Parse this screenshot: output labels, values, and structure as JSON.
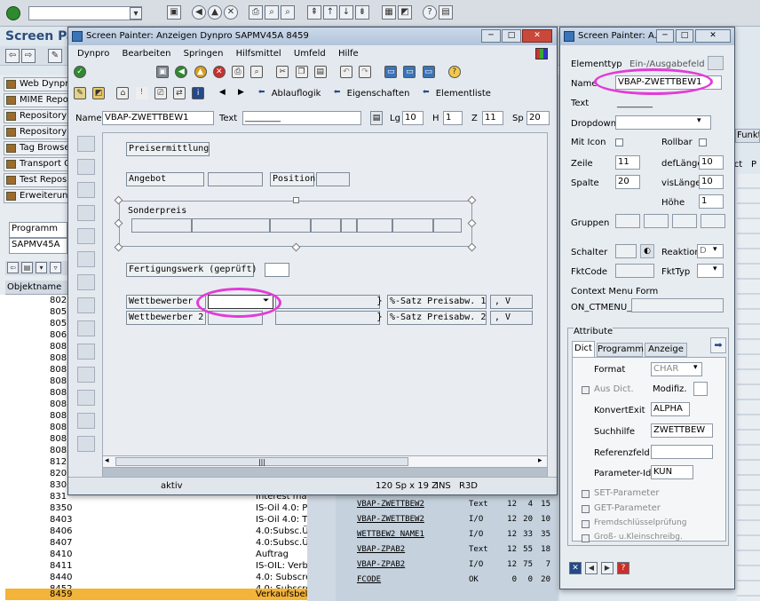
{
  "topbar": {
    "command_value": ""
  },
  "background": {
    "title": "Screen Pa",
    "left_buttons": [
      "Web Dynpro",
      "MIME Repos",
      "Repository B",
      "Repository I",
      "Tag Browse",
      "Transport O",
      "Test Reposi",
      "Erweiterung"
    ],
    "program_label": "Programm",
    "program_value": "SAPMV45A",
    "list_header": "Objektname",
    "list_rows": [
      {
        "n": "802",
        "d": ""
      },
      {
        "n": "805",
        "d": ""
      },
      {
        "n": "805",
        "d": ""
      },
      {
        "n": "806",
        "d": ""
      },
      {
        "n": "808",
        "d": ""
      },
      {
        "n": "808",
        "d": ""
      },
      {
        "n": "808",
        "d": ""
      },
      {
        "n": "808",
        "d": ""
      },
      {
        "n": "808",
        "d": ""
      },
      {
        "n": "808",
        "d": ""
      },
      {
        "n": "808",
        "d": ""
      },
      {
        "n": "808",
        "d": ""
      },
      {
        "n": "808",
        "d": ""
      },
      {
        "n": "808",
        "d": ""
      },
      {
        "n": "812",
        "d": ""
      },
      {
        "n": "820",
        "d": ""
      },
      {
        "n": "830",
        "d": ""
      },
      {
        "n": "831",
        "d": "Interest ma"
      },
      {
        "n": "8350",
        "d": "IS-Oil 4.0: P"
      },
      {
        "n": "8403",
        "d": "IS-Oil 4.0: T"
      },
      {
        "n": "8406",
        "d": "4.0:Subsc.Ü"
      },
      {
        "n": "8407",
        "d": "4.0:Subsc.Ü"
      },
      {
        "n": "8410",
        "d": "Auftrag"
      },
      {
        "n": "8411",
        "d": "IS-OIL: Verb"
      },
      {
        "n": "8440",
        "d": "4.0: Subscre"
      },
      {
        "n": "8452",
        "d": "4.0: Subscre"
      },
      {
        "n": "8459",
        "d": "Verkaufsbel"
      }
    ],
    "right_tab_label": "Funkti",
    "right_cols": [
      "ict",
      "P"
    ],
    "table_rows": [
      {
        "name": "VBAP-ZWETTBEW2",
        "type": "Text",
        "a": "12",
        "b": "4",
        "c": "15"
      },
      {
        "name": "VBAP-ZWETTBEW2",
        "type": "I/O",
        "a": "12",
        "b": "20",
        "c": "10"
      },
      {
        "name": "WETTBEW2_NAME1",
        "type": "I/O",
        "a": "12",
        "b": "33",
        "c": "35"
      },
      {
        "name": "VBAP-ZPAB2",
        "type": "Text",
        "a": "12",
        "b": "55",
        "c": "18"
      },
      {
        "name": "VBAP-ZPAB2",
        "type": "I/O",
        "a": "12",
        "b": "75",
        "c": "7"
      },
      {
        "name": "FCODE",
        "type": "OK",
        "a": "0",
        "b": "0",
        "c": "20"
      }
    ]
  },
  "main_window": {
    "title": "Screen Painter:  Anzeigen Dynpro SAPMV45A 8459",
    "menu": [
      "Dynpro",
      "Bearbeiten",
      "Springen",
      "Hilfsmittel",
      "Umfeld",
      "Hilfe"
    ],
    "toolbar_texts": {
      "ablauflogik": "Ablauflogik",
      "eigenschaften": "Eigenschaften",
      "elementliste": "Elementliste"
    },
    "attr": {
      "name_label": "Name",
      "name_value": "VBAP-ZWETTBEW1",
      "text_label": "Text",
      "text_value": "________",
      "lg_label": "Lg",
      "lg_value": "10",
      "h_label": "H",
      "h_value": "1",
      "z_label": "Z",
      "z_value": "11",
      "sp_label": "Sp",
      "sp_value": "20"
    },
    "screen": {
      "preisermittlung": "Preisermittlung",
      "angebot": "Angebot",
      "position": "Position",
      "sonderpreis": "Sonderpreis",
      "fertigungswerk": "Fertigungswerk (geprüft)",
      "wettbewerber": "Wettbewerber",
      "wettbewerber2": "Wettbewerber 2",
      "psatz1": "%-Satz Preisabw. 1",
      "psatz2": "%-Satz Preisabw. 2",
      "psatz_value": ",  V"
    },
    "status": {
      "mode": "aktiv",
      "size": "120 Sp x 19 Z",
      "ins": "INS",
      "system": "R3D"
    }
  },
  "attr_window": {
    "title": "Screen Painter: A...",
    "elementtyp_label": "Elementtyp",
    "elementtyp_value": "Ein-/Ausgabefeld",
    "name_label": "Name",
    "name_value": "VBAP-ZWETTBEW1",
    "text_label": "Text",
    "text_value": "________",
    "dropdown_label": "Dropdown",
    "mit_icon_label": "Mit Icon",
    "rollbar_label": "Rollbar",
    "zeile_label": "Zeile",
    "zeile_value": "11",
    "deflaenge_label": "defLänge",
    "deflaenge_value": "10",
    "spalte_label": "Spalte",
    "spalte_value": "20",
    "vislaenge_label": "visLänge",
    "vislaenge_value": "10",
    "hoehe_label": "Höhe",
    "hoehe_value": "1",
    "gruppen_label": "Gruppen",
    "schalter_label": "Schalter",
    "reaktion_label": "Reaktion",
    "reaktion_value": "D",
    "fktcode_label": "FktCode",
    "fkttyp_label": "FktTyp",
    "context_label": "Context Menu Form",
    "context_value": "ON_CTMENU_",
    "attribute_label": "Attribute",
    "tabs": [
      "Dict",
      "Programm",
      "Anzeige"
    ],
    "format_label": "Format",
    "format_value": "CHAR",
    "ausdict_label": "Aus Dict.",
    "modifiz_label": "Modifiz.",
    "konvertexit_label": "KonvertExit",
    "konvertexit_value": "ALPHA",
    "suchhilfe_label": "Suchhilfe",
    "suchhilfe_value": "ZWETTBEW",
    "referenzfeld_label": "Referenzfeld",
    "parameterid_label": "Parameter-Id",
    "parameterid_value": "KUN",
    "checkboxes": [
      "SET-Parameter",
      "GET-Parameter",
      "Fremdschlüsselprüfung",
      "Groß- u.Kleinschreibg."
    ]
  },
  "colors": {
    "highlight": "#e23bd7",
    "selection": "#f3b43a"
  }
}
